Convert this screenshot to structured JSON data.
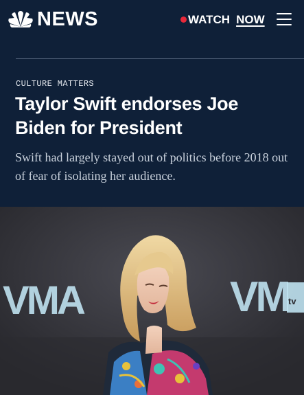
{
  "header": {
    "brand": "NEWS",
    "logo_icon": "peacock-icon",
    "watch_label": "WATCH",
    "now_label": "NOW",
    "live_color": "#e8293a",
    "menu_icon": "hamburger-menu-icon",
    "background": "#0f2038"
  },
  "article": {
    "category": "CULTURE MATTERS",
    "headline": "Taylor Swift endorses Joe Biden for President",
    "dek": "Swift had largely stayed out of politics before 2018 out of fear of isolating her audience."
  },
  "hero_image": {
    "backdrop_text_left": "VMA",
    "backdrop_text_right": "VM",
    "badge": "tv"
  }
}
